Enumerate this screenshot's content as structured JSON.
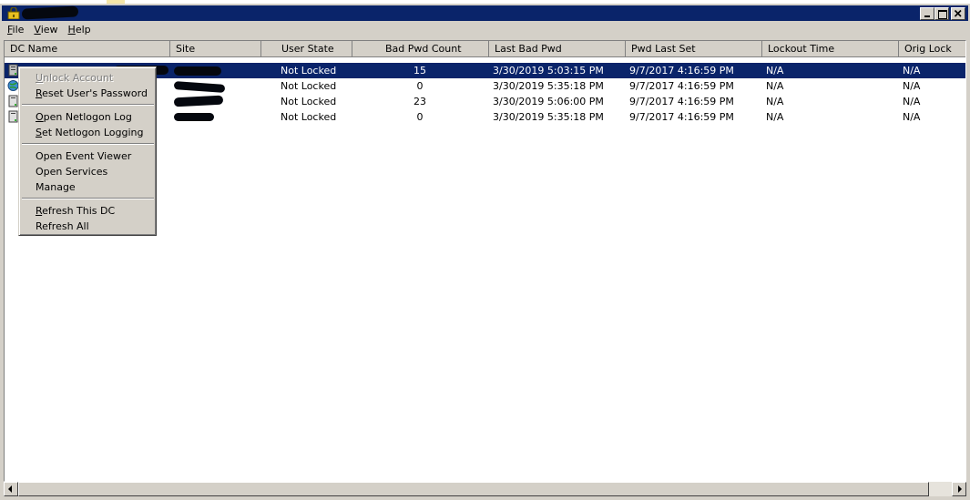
{
  "window": {
    "title": ""
  },
  "menu": [
    {
      "label": "File",
      "accel": "F",
      "rest": "ile"
    },
    {
      "label": "View",
      "accel": "V",
      "rest": "iew"
    },
    {
      "label": "Help",
      "accel": "H",
      "rest": "elp"
    }
  ],
  "columns": [
    "DC Name",
    "Site",
    "User State",
    "Bad Pwd Count",
    "Last Bad Pwd",
    "Pwd Last Set",
    "Lockout Time",
    "Orig Lock"
  ],
  "rows": [
    {
      "user_state": "Not Locked",
      "bad_pwd_count": "15",
      "last_bad_pwd": "3/30/2019 5:03:15 PM",
      "pwd_last_set": "9/7/2017 4:16:59 PM",
      "lockout_time": "N/A",
      "orig_lock": "N/A",
      "selected": true
    },
    {
      "user_state": "Not Locked",
      "bad_pwd_count": "0",
      "last_bad_pwd": "3/30/2019 5:35:18 PM",
      "pwd_last_set": "9/7/2017 4:16:59 PM",
      "lockout_time": "N/A",
      "orig_lock": "N/A",
      "selected": false
    },
    {
      "user_state": "Not Locked",
      "bad_pwd_count": "23",
      "last_bad_pwd": "3/30/2019 5:06:00 PM",
      "pwd_last_set": "9/7/2017 4:16:59 PM",
      "lockout_time": "N/A",
      "orig_lock": "N/A",
      "selected": false
    },
    {
      "user_state": "Not Locked",
      "bad_pwd_count": "0",
      "last_bad_pwd": "3/30/2019 5:35:18 PM",
      "pwd_last_set": "9/7/2017 4:16:59 PM",
      "lockout_time": "N/A",
      "orig_lock": "N/A",
      "selected": false
    }
  ],
  "context_menu": {
    "items": [
      {
        "accel": "U",
        "rest": "nlock Account",
        "disabled": true
      },
      {
        "accel": "R",
        "rest": "eset User's Password",
        "disabled": false
      },
      {
        "accel": "O",
        "rest": "pen Netlogon Log",
        "disabled": false
      },
      {
        "accel": "S",
        "rest": "et Netlogon Logging",
        "disabled": false
      },
      {
        "accel": "",
        "rest": "Open Event Viewer",
        "disabled": false
      },
      {
        "accel": "",
        "rest": "Open Services",
        "disabled": false
      },
      {
        "accel": "",
        "rest": "Manage",
        "disabled": false
      },
      {
        "accel": "R",
        "rest": "efresh This DC",
        "disabled": false
      },
      {
        "accel": "",
        "rest": "Refresh All",
        "disabled": false
      }
    ]
  },
  "colors": {
    "title_bg": "#0a246a",
    "face": "#d4d0c8",
    "selection": "#0a246a"
  },
  "icons": {
    "app": "lock-app-icon",
    "row": "server-icon"
  }
}
